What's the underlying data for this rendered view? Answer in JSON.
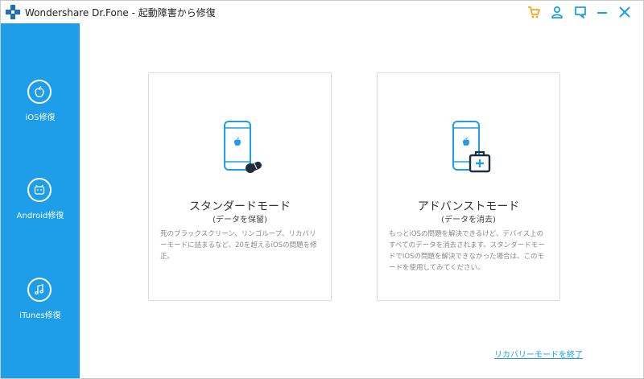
{
  "window": {
    "title": "Wondershare Dr.Fone - 起動障害から修復",
    "colors": {
      "accent": "#1e9ee8",
      "cart": "#f5a623",
      "sidebar_text": "#ffffff"
    }
  },
  "titlebar": {
    "icons": [
      "cart-icon",
      "user-icon",
      "feedback-icon",
      "minimize-icon",
      "close-icon"
    ]
  },
  "sidebar": {
    "items": [
      {
        "label": "iOS修復",
        "icon": "apple-icon"
      },
      {
        "label": "Android修復",
        "icon": "android-icon"
      },
      {
        "label": "iTunes修復",
        "icon": "music-note-icon"
      }
    ]
  },
  "main": {
    "cards": [
      {
        "title": "スタンダードモード",
        "subtitle": "(データを保留)",
        "description": "死のブラックスクリーン、リンゴループ、リカバリーモードに詰まるなど、20を超えるiOSの問題を修正。",
        "icon": "phone-with-pills-icon"
      },
      {
        "title": "アドバンストモード",
        "subtitle": "(データを消去)",
        "description": "もっとiOSの問題を解決できるけど、デバイス上のすべてのデータを消去されます。スタンダードモードでiOSの問題を解決できなかった場合は、このモードを使用してみてください。",
        "icon": "phone-with-medkit-icon"
      }
    ],
    "exit_link": "リカバリーモードを終了"
  }
}
